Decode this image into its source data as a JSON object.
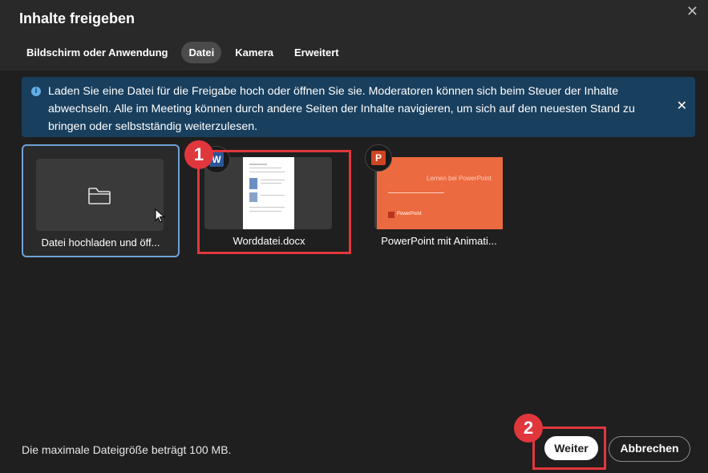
{
  "dialog": {
    "title": "Inhalte freigeben",
    "close_icon": "close-icon"
  },
  "tabs": [
    {
      "label": "Bildschirm oder Anwendung",
      "active": false
    },
    {
      "label": "Datei",
      "active": true
    },
    {
      "label": "Kamera",
      "active": false
    },
    {
      "label": "Erweitert",
      "active": false
    }
  ],
  "banner": {
    "icon": "info-icon",
    "text": "Laden Sie eine Datei für die Freigabe hoch oder öffnen Sie sie. Moderatoren können sich beim Steuer der Inhalte abwechseln. Alle im Meeting können durch andere Seiten der Inhalte navigieren, um sich auf den neuesten Stand zu bringen oder selbstständig weiterzulesen.",
    "close_icon": "close-icon",
    "color": "#193f5e"
  },
  "files": [
    {
      "label": "Datei hochladen und öff...",
      "icon": "folder-icon",
      "selected": true
    },
    {
      "label": "Worddatei.docx",
      "icon": "word-icon",
      "icon_letter": "W"
    },
    {
      "label": "PowerPoint mit Animati...",
      "icon": "powerpoint-icon",
      "icon_letter": "P",
      "slide_heading": "Lernen bei PowerPoint",
      "slide_brand": "PowerPoint"
    }
  ],
  "annotations": {
    "step1": "1",
    "step2": "2",
    "color": "#e0373d"
  },
  "footer": {
    "max_size_text": "Die maximale Dateigröße beträgt 100 MB.",
    "next_label": "Weiter",
    "cancel_label": "Abbrechen"
  }
}
